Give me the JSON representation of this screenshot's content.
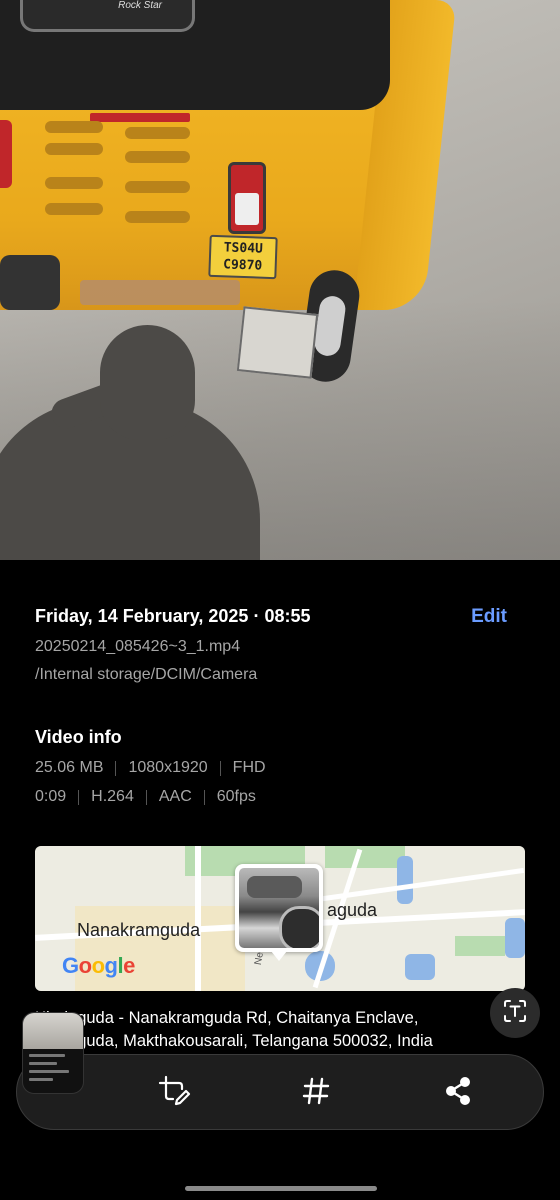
{
  "photo": {
    "roof_badge_text": "Rock Star",
    "plate_line1": "TS04U",
    "plate_line2": "C9870"
  },
  "details": {
    "datetime": "Friday, 14 February, 2025 · 08:55",
    "edit_label": "Edit",
    "filename": "20250214_085426~3_1.mp4",
    "path": "/Internal storage/DCIM/Camera"
  },
  "video_info": {
    "title": "Video info",
    "size": "25.06 MB",
    "resolution": "1080x1920",
    "quality": "FHD",
    "duration": "0:09",
    "codec": "H.264",
    "audio": "AAC",
    "fps": "60fps"
  },
  "map": {
    "label_left": "Nanakramguda",
    "label_right": "aguda",
    "road_label": "Nehru",
    "logo": "Google"
  },
  "address": {
    "line1": "Khajaguda - Nanakramguda Rd, Chaitanya Enclave,",
    "line2": "Khajaguda, Makthakousarali, Telangana 500032, India"
  },
  "icons": {
    "text_scan": "text-scan-icon",
    "crop": "crop-edit-icon",
    "tag": "hashtag-icon",
    "share": "share-icon"
  },
  "colors": {
    "accent": "#6b9cff",
    "background": "#000000",
    "secondary_text": "#a6a6a6"
  }
}
